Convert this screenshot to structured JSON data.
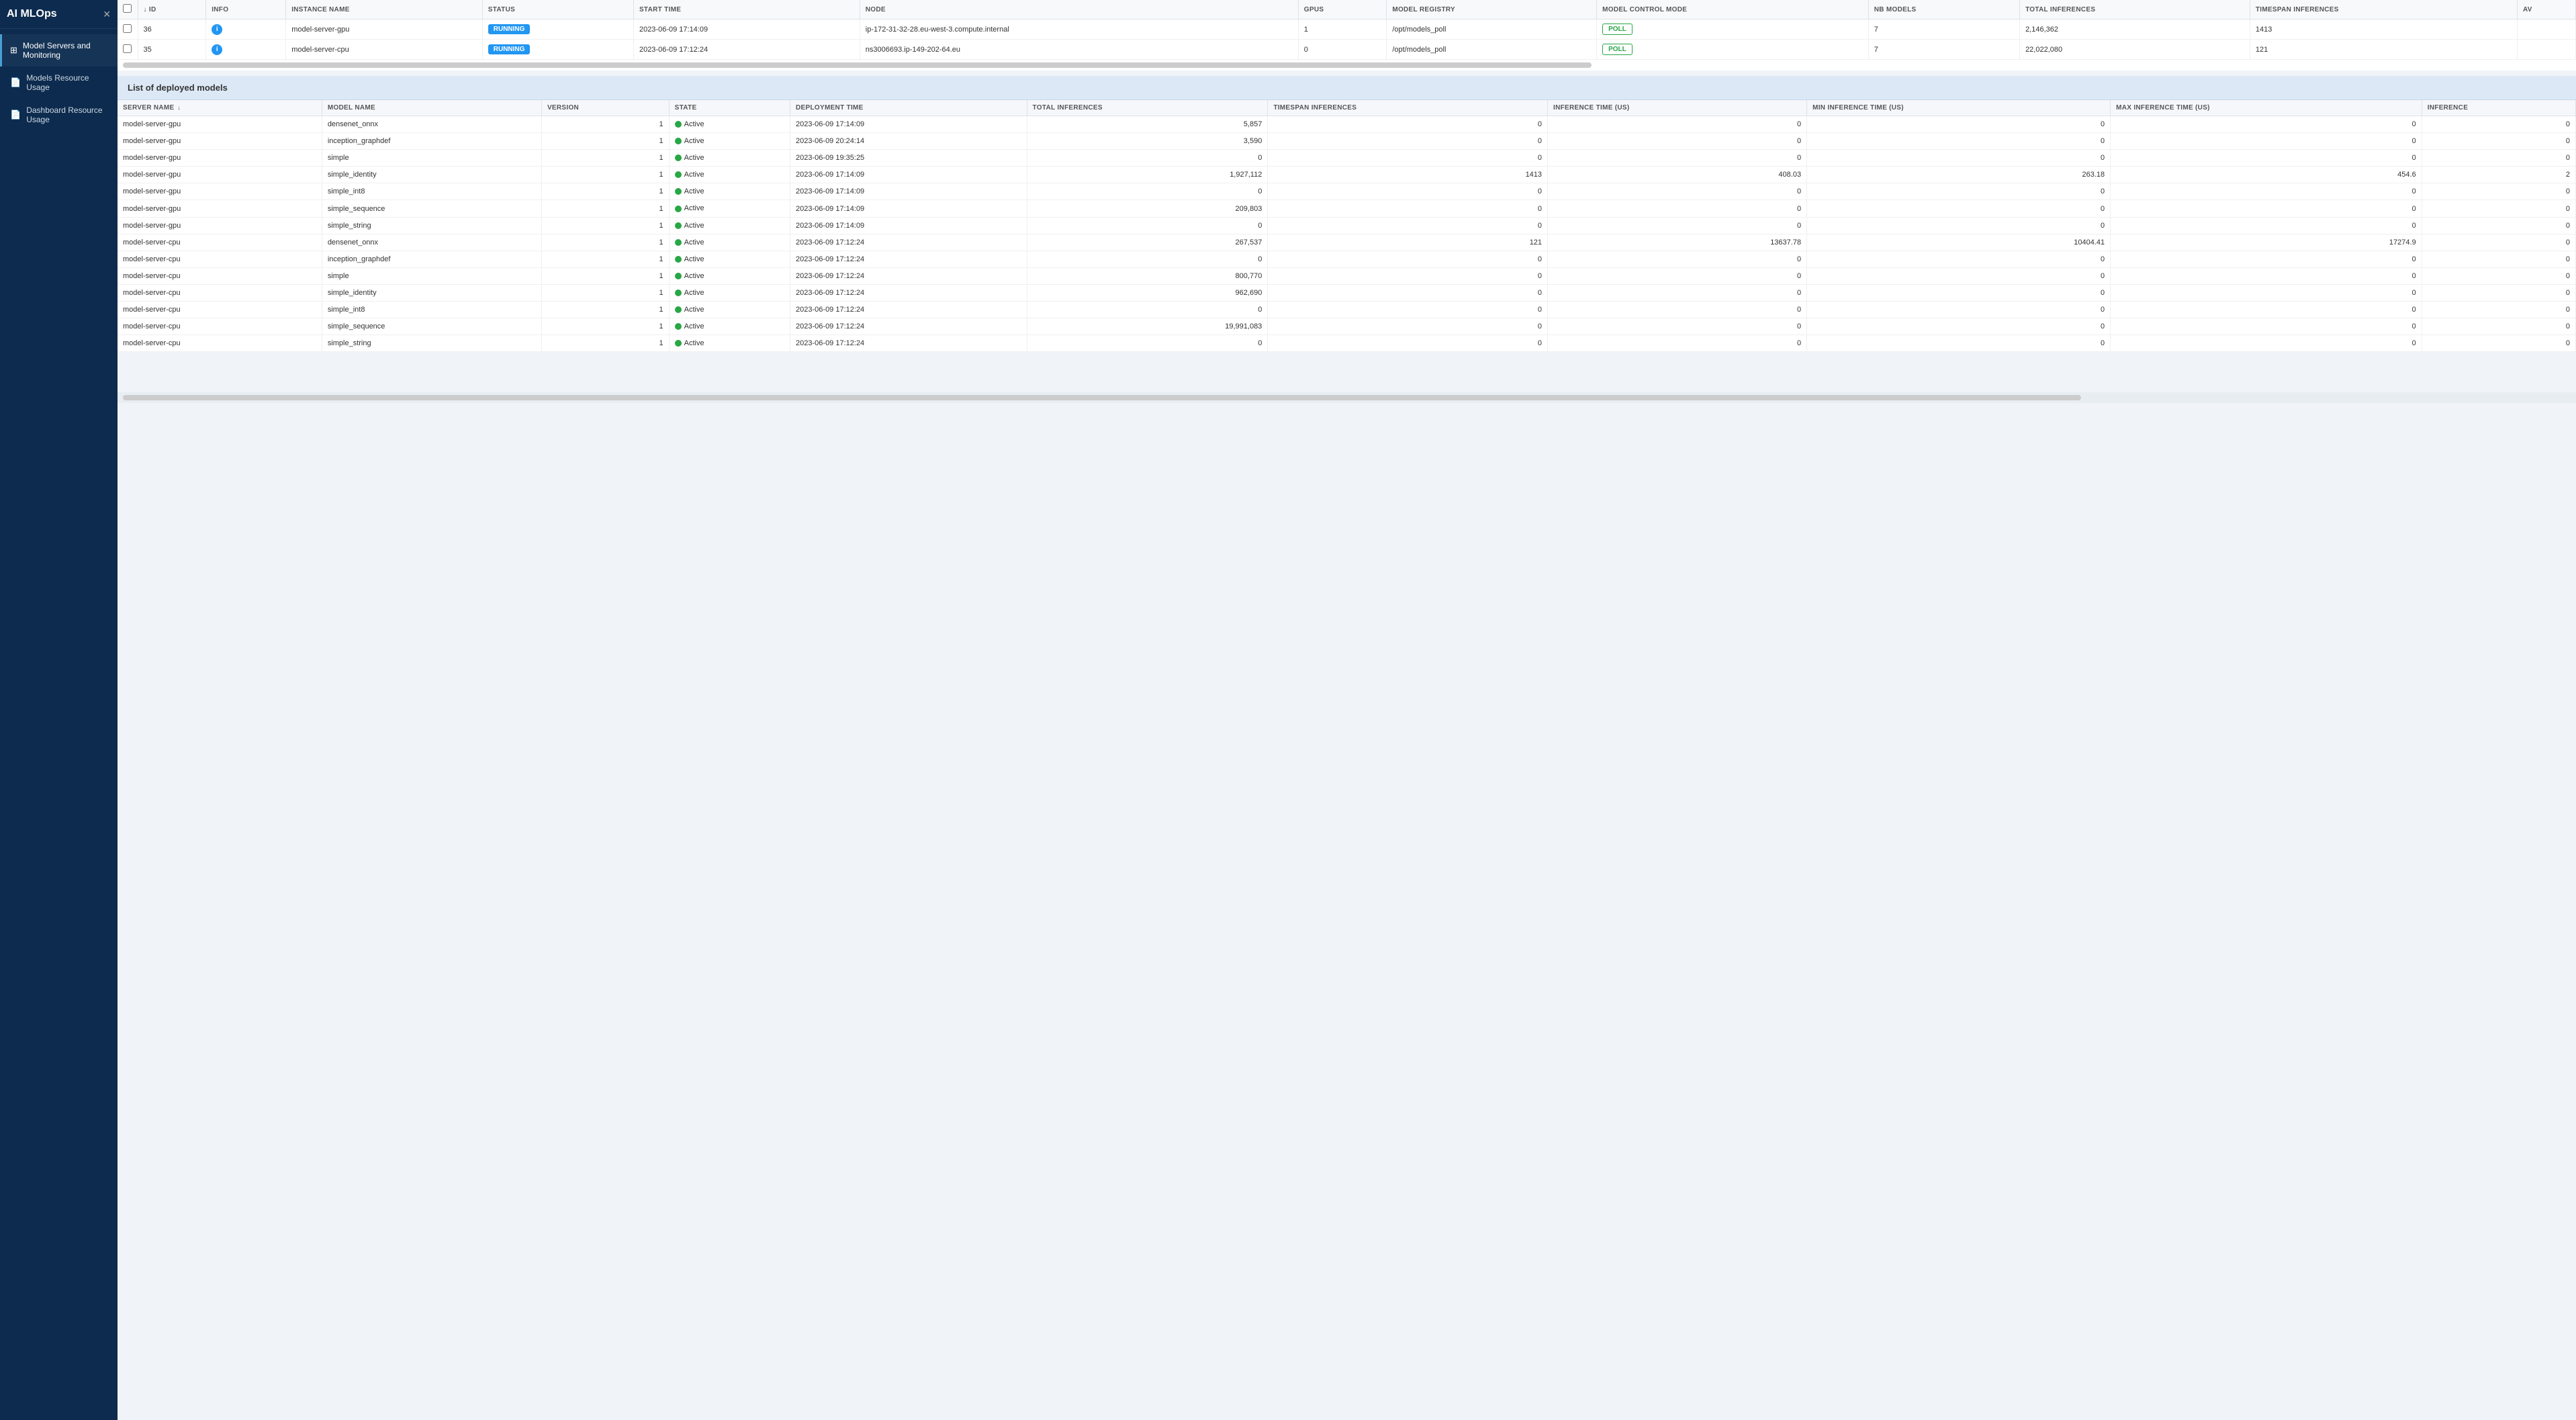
{
  "app": {
    "title": "AI MLOps"
  },
  "sidebar": {
    "items": [
      {
        "id": "model-servers",
        "label": "Model Servers and Monitoring",
        "active": true,
        "icon": "⊞"
      },
      {
        "id": "models-resource",
        "label": "Models Resource Usage",
        "active": false,
        "icon": "📄"
      },
      {
        "id": "dashboard-resource",
        "label": "Dashboard Resource Usage",
        "active": false,
        "icon": "📄"
      }
    ]
  },
  "top_table": {
    "columns": [
      {
        "id": "checkbox",
        "label": ""
      },
      {
        "id": "id",
        "label": "↓ ID"
      },
      {
        "id": "info",
        "label": "INFO"
      },
      {
        "id": "instance_name",
        "label": "INSTANCE NAME"
      },
      {
        "id": "status",
        "label": "STATUS"
      },
      {
        "id": "start_time",
        "label": "START TIME"
      },
      {
        "id": "node",
        "label": "NODE"
      },
      {
        "id": "gpus",
        "label": "GPUS"
      },
      {
        "id": "model_registry",
        "label": "MODEL REGISTRY"
      },
      {
        "id": "model_control_mode",
        "label": "MODEL CONTROL MODE"
      },
      {
        "id": "nb_models",
        "label": "NB MODELS"
      },
      {
        "id": "total_inferences",
        "label": "TOTAL INFERENCES"
      },
      {
        "id": "timespan_inferences",
        "label": "TIMESPAN INFERENCES"
      },
      {
        "id": "av",
        "label": "AV"
      }
    ],
    "rows": [
      {
        "id": 36,
        "instance_name": "model-server-gpu",
        "status": "RUNNING",
        "start_time": "2023-06-09 17:14:09",
        "node": "ip-172-31-32-28.eu-west-3.compute.internal",
        "gpus": 1,
        "model_registry": "/opt/models_poll",
        "model_control_mode": "POLL",
        "nb_models": 7,
        "total_inferences": 2146362,
        "timespan_inferences": 1413
      },
      {
        "id": 35,
        "instance_name": "model-server-cpu",
        "status": "RUNNING",
        "start_time": "2023-06-09 17:12:24",
        "node": "ns3006693.ip-149-202-64.eu",
        "gpus": 0,
        "model_registry": "/opt/models_poll",
        "model_control_mode": "POLL",
        "nb_models": 7,
        "total_inferences": 22022080,
        "timespan_inferences": 121
      }
    ]
  },
  "deployed_models": {
    "section_title": "List of deployed models",
    "columns": [
      {
        "id": "server_name",
        "label": "SERVER NAME",
        "sortable": true
      },
      {
        "id": "model_name",
        "label": "MODEL NAME"
      },
      {
        "id": "version",
        "label": "VERSION"
      },
      {
        "id": "state",
        "label": "STATE"
      },
      {
        "id": "deployment_time",
        "label": "DEPLOYMENT TIME"
      },
      {
        "id": "total_inferences",
        "label": "TOTAL INFERENCES"
      },
      {
        "id": "timespan_inferences",
        "label": "TIMESPAN INFERENCES"
      },
      {
        "id": "inference_time_us",
        "label": "INFERENCE TIME (us)"
      },
      {
        "id": "min_inference_time_us",
        "label": "MIN INFERENCE TIME (us)"
      },
      {
        "id": "max_inference_time_us",
        "label": "MAX INFERENCE TIME (us)"
      },
      {
        "id": "inference",
        "label": "INFERENCE"
      }
    ],
    "rows": [
      {
        "server_name": "model-server-gpu",
        "model_name": "densenet_onnx",
        "version": 1,
        "state": "Active",
        "deployment_time": "2023-06-09 17:14:09",
        "total_inferences": 5857,
        "timespan_inferences": 0,
        "inference_time_us": 0,
        "min_inference_time_us": 0,
        "max_inference_time_us": 0,
        "inference": 0
      },
      {
        "server_name": "model-server-gpu",
        "model_name": "inception_graphdef",
        "version": 1,
        "state": "Active",
        "deployment_time": "2023-06-09 20:24:14",
        "total_inferences": 3590,
        "timespan_inferences": 0,
        "inference_time_us": 0,
        "min_inference_time_us": 0,
        "max_inference_time_us": 0,
        "inference": 0
      },
      {
        "server_name": "model-server-gpu",
        "model_name": "simple",
        "version": 1,
        "state": "Active",
        "deployment_time": "2023-06-09 19:35:25",
        "total_inferences": 0,
        "timespan_inferences": 0,
        "inference_time_us": 0,
        "min_inference_time_us": 0,
        "max_inference_time_us": 0,
        "inference": 0
      },
      {
        "server_name": "model-server-gpu",
        "model_name": "simple_identity",
        "version": 1,
        "state": "Active",
        "deployment_time": "2023-06-09 17:14:09",
        "total_inferences": 1927112,
        "timespan_inferences": 1413,
        "inference_time_us": 408.03,
        "min_inference_time_us": 263.18,
        "max_inference_time_us": 454.6,
        "inference": 2
      },
      {
        "server_name": "model-server-gpu",
        "model_name": "simple_int8",
        "version": 1,
        "state": "Active",
        "deployment_time": "2023-06-09 17:14:09",
        "total_inferences": 0,
        "timespan_inferences": 0,
        "inference_time_us": 0,
        "min_inference_time_us": 0,
        "max_inference_time_us": 0,
        "inference": 0
      },
      {
        "server_name": "model-server-gpu",
        "model_name": "simple_sequence",
        "version": 1,
        "state": "Active",
        "deployment_time": "2023-06-09 17:14:09",
        "total_inferences": 209803,
        "timespan_inferences": 0,
        "inference_time_us": 0,
        "min_inference_time_us": 0,
        "max_inference_time_us": 0,
        "inference": 0
      },
      {
        "server_name": "model-server-gpu",
        "model_name": "simple_string",
        "version": 1,
        "state": "Active",
        "deployment_time": "2023-06-09 17:14:09",
        "total_inferences": 0,
        "timespan_inferences": 0,
        "inference_time_us": 0,
        "min_inference_time_us": 0,
        "max_inference_time_us": 0,
        "inference": 0
      },
      {
        "server_name": "model-server-cpu",
        "model_name": "densenet_onnx",
        "version": 1,
        "state": "Active",
        "deployment_time": "2023-06-09 17:12:24",
        "total_inferences": 267537,
        "timespan_inferences": 121,
        "inference_time_us": 13637.78,
        "min_inference_time_us": 10404.41,
        "max_inference_time_us": 17274.9,
        "inference": 0
      },
      {
        "server_name": "model-server-cpu",
        "model_name": "inception_graphdef",
        "version": 1,
        "state": "Active",
        "deployment_time": "2023-06-09 17:12:24",
        "total_inferences": 0,
        "timespan_inferences": 0,
        "inference_time_us": 0,
        "min_inference_time_us": 0,
        "max_inference_time_us": 0,
        "inference": 0
      },
      {
        "server_name": "model-server-cpu",
        "model_name": "simple",
        "version": 1,
        "state": "Active",
        "deployment_time": "2023-06-09 17:12:24",
        "total_inferences": 800770,
        "timespan_inferences": 0,
        "inference_time_us": 0,
        "min_inference_time_us": 0,
        "max_inference_time_us": 0,
        "inference": 0
      },
      {
        "server_name": "model-server-cpu",
        "model_name": "simple_identity",
        "version": 1,
        "state": "Active",
        "deployment_time": "2023-06-09 17:12:24",
        "total_inferences": 962690,
        "timespan_inferences": 0,
        "inference_time_us": 0,
        "min_inference_time_us": 0,
        "max_inference_time_us": 0,
        "inference": 0
      },
      {
        "server_name": "model-server-cpu",
        "model_name": "simple_int8",
        "version": 1,
        "state": "Active",
        "deployment_time": "2023-06-09 17:12:24",
        "total_inferences": 0,
        "timespan_inferences": 0,
        "inference_time_us": 0,
        "min_inference_time_us": 0,
        "max_inference_time_us": 0,
        "inference": 0
      },
      {
        "server_name": "model-server-cpu",
        "model_name": "simple_sequence",
        "version": 1,
        "state": "Active",
        "deployment_time": "2023-06-09 17:12:24",
        "total_inferences": 19991083,
        "timespan_inferences": 0,
        "inference_time_us": 0,
        "min_inference_time_us": 0,
        "max_inference_time_us": 0,
        "inference": 0
      },
      {
        "server_name": "model-server-cpu",
        "model_name": "simple_string",
        "version": 1,
        "state": "Active",
        "deployment_time": "2023-06-09 17:12:24",
        "total_inferences": 0,
        "timespan_inferences": 0,
        "inference_time_us": 0,
        "min_inference_time_us": 0,
        "max_inference_time_us": 0,
        "inference": 0
      }
    ]
  }
}
